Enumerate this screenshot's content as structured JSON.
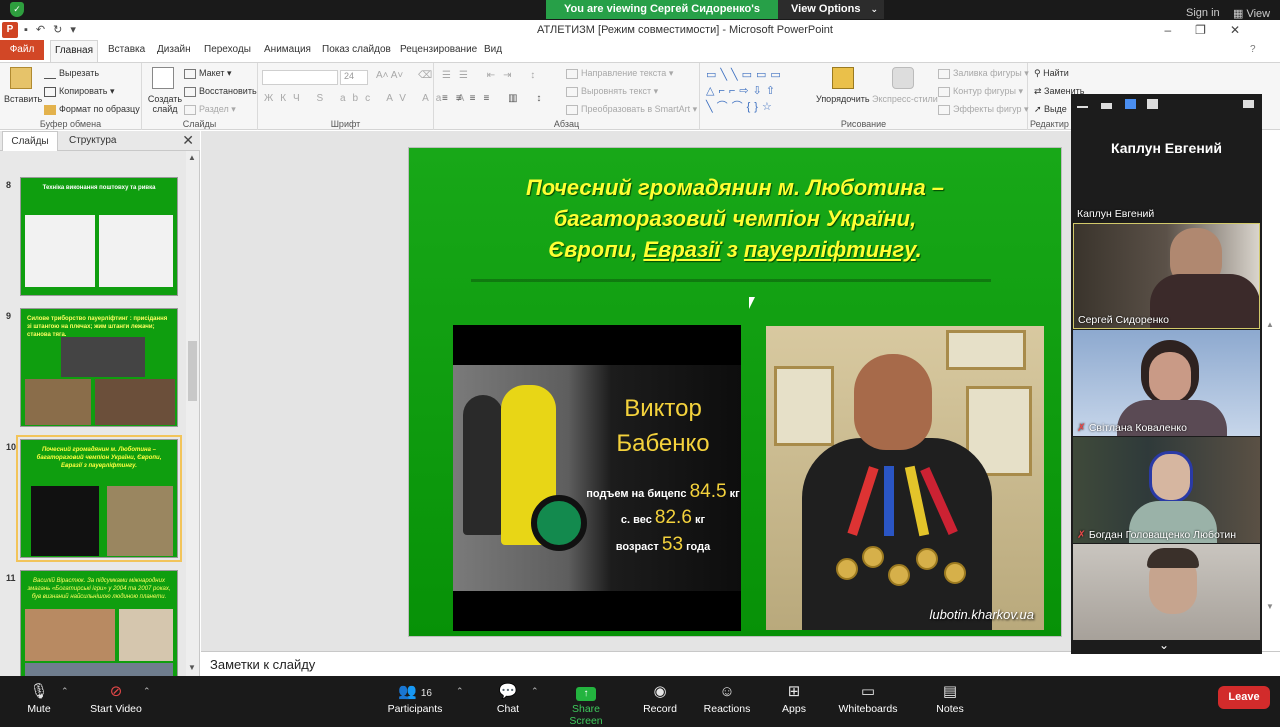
{
  "zoom_top": {
    "viewing_banner": "You are viewing Сергей Сидоренко's screen",
    "view_options": "View Options",
    "sign_in": "Sign in",
    "view": "View"
  },
  "ppt": {
    "window_title": "АТЛЕТИЗМ [Режим совместимости] - Microsoft PowerPoint",
    "tabs": [
      "Файл",
      "Главная",
      "Вставка",
      "Дизайн",
      "Переходы",
      "Анимация",
      "Показ слайдов",
      "Рецензирование",
      "Вид"
    ],
    "ribbon": {
      "clipboard": {
        "label": "Буфер обмена",
        "paste": "Вставить",
        "cut": "Вырезать",
        "copy": "Копировать",
        "format_painter": "Формат по образцу"
      },
      "slides": {
        "label": "Слайды",
        "new_slide": "Создать слайд",
        "layout": "Макет",
        "reset": "Восстановить",
        "section": "Раздел"
      },
      "font": {
        "label": "Шрифт",
        "size": "24"
      },
      "paragraph": {
        "label": "Абзац",
        "text_direction": "Направление текста",
        "align_text": "Выровнять текст",
        "smartart": "Преобразовать в SmartArt"
      },
      "drawing": {
        "label": "Рисование",
        "arrange": "Упорядочить",
        "quick_styles": "Экспресс-стили",
        "shape_fill": "Заливка фигуры",
        "shape_outline": "Контур фигуры",
        "shape_effects": "Эффекты фигур"
      },
      "editing": {
        "label": "Редактир",
        "find": "Найти",
        "replace": "Заменить",
        "select": "Выде"
      }
    },
    "panel": {
      "tab_slides": "Слайды",
      "tab_outline": "Структура",
      "thumbs": [
        {
          "num": "8",
          "title": "Техніка виконання поштовху та ривка"
        },
        {
          "num": "9",
          "title": "Силове триборство пауерліфтинг : присідання зі штангою на плечах; жим штанги лежачи; станова тяга."
        },
        {
          "num": "10",
          "title": "Почесний громадянин м. Люботина – багаторазовий чемпіон України, Європи, Евразії з пауерліфтингу."
        },
        {
          "num": "11",
          "title": "Василій Вірастюк. За підсумками міжнародних змагань «Богатирські ігри» у 2004 та 2007 роках, був визнаний найсильнішою людиною планети."
        }
      ]
    },
    "slide": {
      "title_line1": "Почесний громадянин м. Люботина –",
      "title_line2": "багаторазовий чемпіон України,",
      "title_line3_a": "Європи, ",
      "title_line3_b": "Евразії",
      "title_line3_c": " з ",
      "title_line3_d": "пауерліфтингу",
      "title_line3_e": ".",
      "victor_first": "Виктор",
      "victor_last": "Бабенко",
      "stat1_label": "подъем на бицепс",
      "stat1_value": "84.5",
      "stat1_unit": "кг",
      "stat2_label": "с. вес",
      "stat2_value": "82.6",
      "stat2_unit": "кг",
      "stat3_label": "возраст",
      "stat3_value": "53",
      "stat3_unit": "года",
      "watermark": "lubotin.kharkov.ua"
    },
    "notes_placeholder": "Заметки к слайду"
  },
  "gallery": {
    "active_speaker_name": "Каплун Евгений",
    "participants": [
      {
        "name": "Каплун Евгений",
        "muted": false
      },
      {
        "name": "Сергей Сидоренко",
        "muted": false
      },
      {
        "name": "Світлана Коваленко",
        "muted": true
      },
      {
        "name": "Богдан Головащенко Люботин",
        "muted": true
      }
    ]
  },
  "zoom_bar": {
    "mute": "Mute",
    "start_video": "Start Video",
    "participants": "Participants",
    "participants_count": "16",
    "chat": "Chat",
    "share_screen": "Share Screen",
    "record": "Record",
    "reactions": "Reactions",
    "apps": "Apps",
    "whiteboards": "Whiteboards",
    "notes": "Notes",
    "leave": "Leave"
  }
}
